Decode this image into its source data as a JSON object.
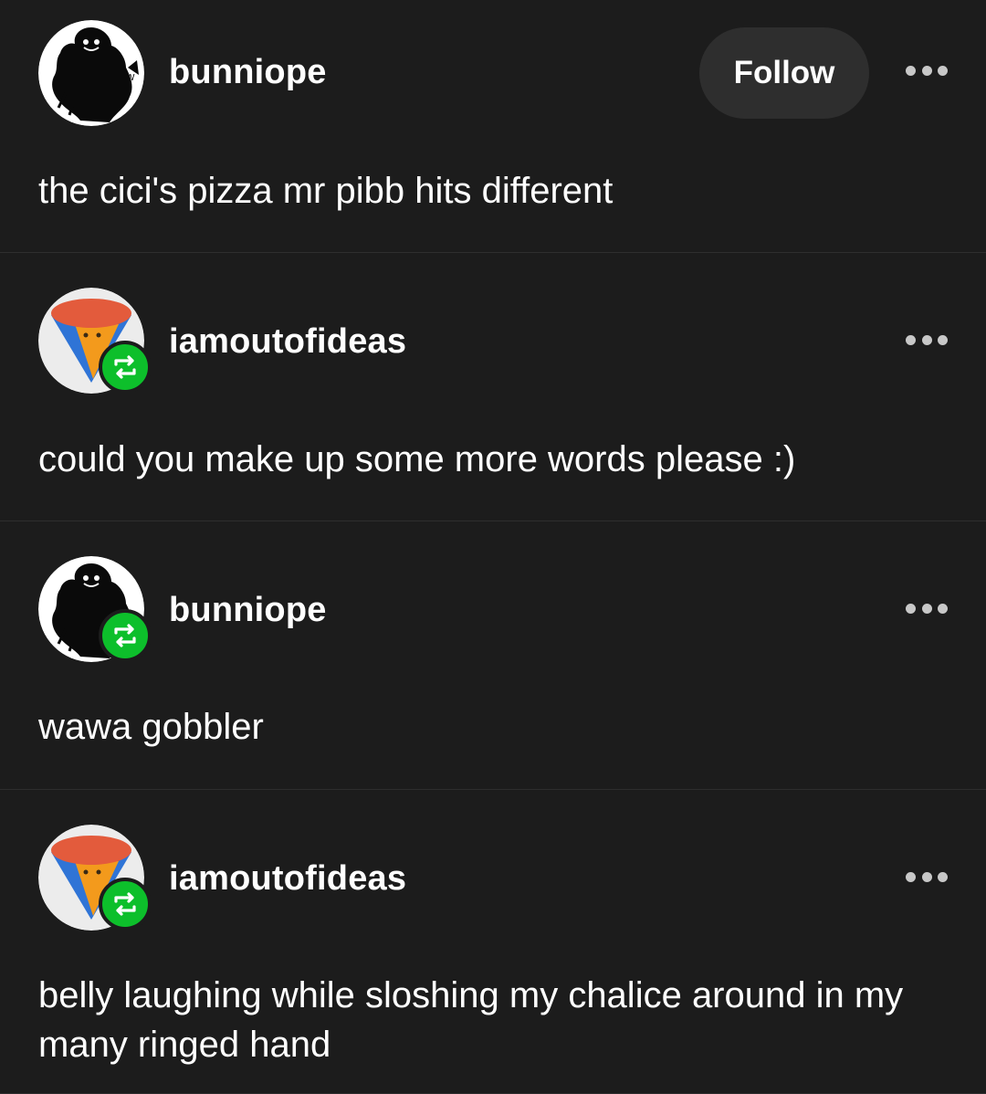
{
  "posts": [
    {
      "username": "bunniope",
      "text": "the cici's pizza mr pibb hits different",
      "avatar_icon": "silhouette-avatar-icon",
      "show_follow": true,
      "reblog": false
    },
    {
      "username": "iamoutofideas",
      "text": "could you make up some more words please :)",
      "avatar_icon": "pizza-slice-avatar-icon",
      "show_follow": false,
      "reblog": true
    },
    {
      "username": "bunniope",
      "text": "wawa gobbler",
      "avatar_icon": "silhouette-avatar-icon",
      "show_follow": false,
      "reblog": true
    },
    {
      "username": "iamoutofideas",
      "text": "belly laughing while sloshing my chalice around in my many ringed hand",
      "avatar_icon": "pizza-slice-avatar-icon",
      "show_follow": false,
      "reblog": true
    }
  ],
  "follow_label": "Follow",
  "colors": {
    "background": "#1c1c1c",
    "reblog_badge": "#0dbf2b",
    "follow_button": "#2e2e2e"
  }
}
